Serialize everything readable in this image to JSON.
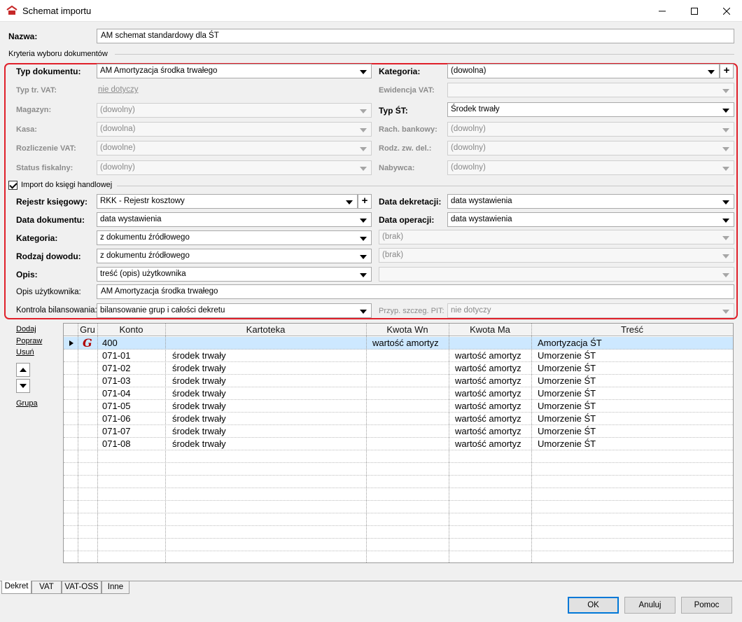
{
  "window": {
    "title": "Schemat importu"
  },
  "nazwa": {
    "label": "Nazwa:",
    "value": "AM schemat standardowy dla ŚT"
  },
  "kryteria": {
    "section_label": "Kryteria wyboru dokumentów",
    "typ_dokumentu": {
      "label": "Typ dokumentu:",
      "value": "AM Amortyzacja środka trwałego"
    },
    "kategoria": {
      "label": "Kategoria:",
      "value": "(dowolna)"
    },
    "typ_tr_vat": {
      "label": "Typ tr. VAT:",
      "value": "nie dotyczy"
    },
    "ewidencja_vat": {
      "label": "Ewidencja VAT:",
      "value": ""
    },
    "magazyn": {
      "label": "Magazyn:",
      "value": "(dowolny)"
    },
    "typ_st": {
      "label": "Typ ŚT:",
      "value": "Środek trwały"
    },
    "kasa": {
      "label": "Kasa:",
      "value": "(dowolna)"
    },
    "rach_bankowy": {
      "label": "Rach. bankowy:",
      "value": "(dowolny)"
    },
    "rozliczenie_vat": {
      "label": "Rozliczenie VAT:",
      "value": "(dowolne)"
    },
    "rodz_zw_del": {
      "label": "Rodz. zw. del.:",
      "value": "(dowolny)"
    },
    "status_fiskalny": {
      "label": "Status fiskalny:",
      "value": "(dowolny)"
    },
    "nabywca": {
      "label": "Nabywca:",
      "value": "(dowolny)"
    }
  },
  "import": {
    "checkbox_label": "Import do księgi handlowej",
    "checked": true,
    "rejestr_ksiegowy": {
      "label": "Rejestr księgowy:",
      "value": "RKK - Rejestr kosztowy"
    },
    "data_dekretacji": {
      "label": "Data dekretacji:",
      "value": "data wystawienia"
    },
    "data_dokumentu": {
      "label": "Data dokumentu:",
      "value": "data wystawienia"
    },
    "data_operacji": {
      "label": "Data operacji:",
      "value": "data wystawienia"
    },
    "kategoria": {
      "label": "Kategoria:",
      "value": "z dokumentu źródłowego",
      "right_value": "(brak)"
    },
    "rodzaj_dowodu": {
      "label": "Rodzaj dowodu:",
      "value": "z dokumentu źródłowego",
      "right_value": "(brak)"
    },
    "opis": {
      "label": "Opis:",
      "value": "treść (opis) użytkownika",
      "right_value": ""
    },
    "opis_uzytkownika": {
      "label": "Opis użytkownika:",
      "value": "AM Amortyzacja środka trwałego"
    },
    "kontrola_bilansowania": {
      "label": "Kontrola bilansowania:",
      "value": "bilansowanie grup i całości dekretu"
    },
    "przyp_szczeg_pit": {
      "label": "Przyp. szczeg. PIT:",
      "value": "nie dotyczy"
    }
  },
  "side_actions": {
    "dodaj": "Dodaj",
    "popraw": "Popraw",
    "usun": "Usuń",
    "grupa": "Grupa"
  },
  "grid": {
    "columns": [
      "Gru",
      "Konto",
      "Kartoteka",
      "Kwota Wn",
      "Kwota Ma",
      "Treść"
    ],
    "rows": [
      {
        "konto": "400",
        "kartoteka": "",
        "wn": "wartość amortyz",
        "ma": "",
        "tresc": "Amortyzacja ŚT"
      },
      {
        "konto": "071-01",
        "kartoteka": "środek trwały",
        "wn": "",
        "ma": "wartość amortyz",
        "tresc": "Umorzenie ŚT"
      },
      {
        "konto": "071-02",
        "kartoteka": "środek trwały",
        "wn": "",
        "ma": "wartość amortyz",
        "tresc": "Umorzenie ŚT"
      },
      {
        "konto": "071-03",
        "kartoteka": "środek trwały",
        "wn": "",
        "ma": "wartość amortyz",
        "tresc": "Umorzenie ŚT"
      },
      {
        "konto": "071-04",
        "kartoteka": "środek trwały",
        "wn": "",
        "ma": "wartość amortyz",
        "tresc": "Umorzenie ŚT"
      },
      {
        "konto": "071-05",
        "kartoteka": "środek trwały",
        "wn": "",
        "ma": "wartość amortyz",
        "tresc": "Umorzenie ŚT"
      },
      {
        "konto": "071-06",
        "kartoteka": "środek trwały",
        "wn": "",
        "ma": "wartość amortyz",
        "tresc": "Umorzenie ŚT"
      },
      {
        "konto": "071-07",
        "kartoteka": "środek trwały",
        "wn": "",
        "ma": "wartość amortyz",
        "tresc": "Umorzenie ŚT"
      },
      {
        "konto": "071-08",
        "kartoteka": "środek trwały",
        "wn": "",
        "ma": "wartość amortyz",
        "tresc": "Umorzenie ŚT"
      }
    ],
    "group_icon_glyph": "G"
  },
  "tabs": [
    "Dekret",
    "VAT",
    "VAT-OSS",
    "Inne"
  ],
  "buttons": {
    "ok": "OK",
    "anuluj": "Anuluj",
    "pomoc": "Pomoc"
  }
}
